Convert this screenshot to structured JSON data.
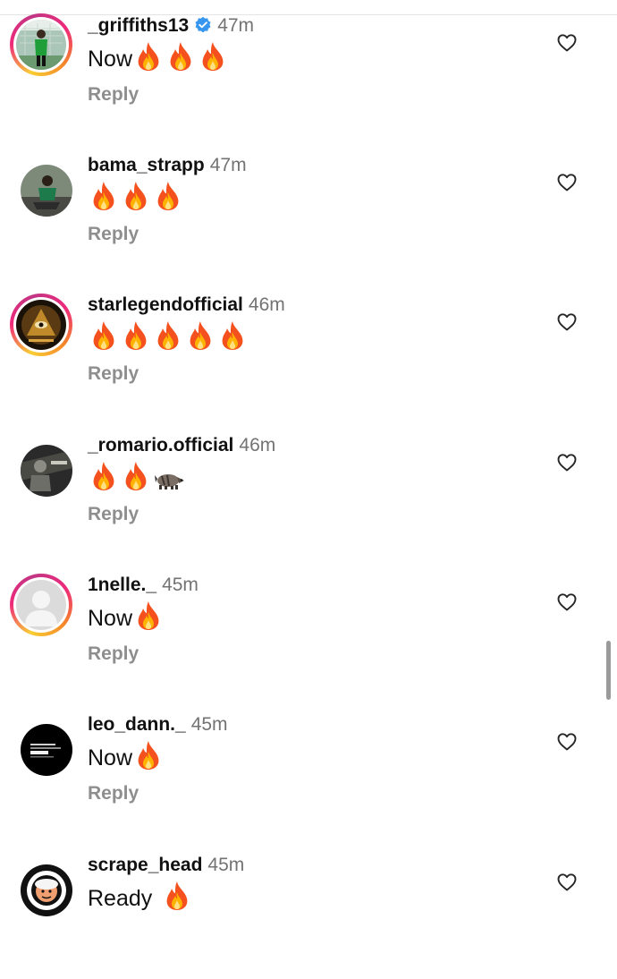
{
  "reply_label": "Reply",
  "comments": [
    {
      "username": "_griffiths13",
      "verified": true,
      "time": "47m",
      "text": "Now",
      "emoji": "fire-emoji ×3",
      "story_ring": true
    },
    {
      "username": "bama_strapp",
      "verified": false,
      "time": "47m",
      "text": "",
      "emoji": "fire-emoji ×3",
      "story_ring": false
    },
    {
      "username": "starlegendofficial",
      "verified": false,
      "time": "46m",
      "text": "",
      "emoji": "fire-emoji ×5",
      "story_ring": true
    },
    {
      "username": "_romario.official",
      "verified": false,
      "time": "46m",
      "text": "",
      "emoji": "fire-emoji ×2, raccoon-emoji",
      "story_ring": false
    },
    {
      "username": "1nelle._",
      "verified": false,
      "time": "45m",
      "text": "Now",
      "emoji": "fire-emoji",
      "story_ring": true
    },
    {
      "username": "leo_dann._",
      "verified": false,
      "time": "45m",
      "text": "Now",
      "emoji": "fire-emoji",
      "story_ring": false
    },
    {
      "username": "scrape_head",
      "verified": false,
      "time": "45m",
      "text": "Ready",
      "emoji": "fire-emoji",
      "story_ring": false
    }
  ],
  "colors": {
    "username": "#111111",
    "timestamp": "#737373",
    "reply": "#8e8e8e",
    "verified": "#3797f0",
    "story_ring": [
      "#f9ce34",
      "#ee2a7b",
      "#c13584",
      "#f58529"
    ]
  }
}
